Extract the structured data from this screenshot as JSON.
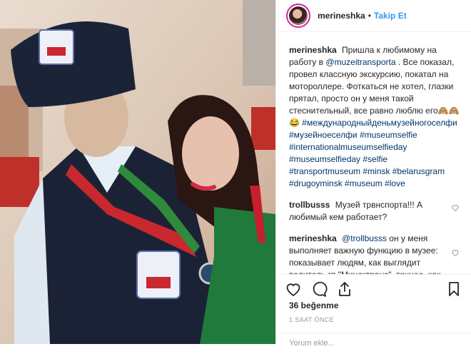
{
  "header": {
    "username": "merineshka",
    "separator": "•",
    "follow_label": "Takip Et"
  },
  "caption": {
    "username": "merineshka",
    "text_before_mention": "Пришла к любимому на работу в ",
    "mention": "@muzeitransporta",
    "text_after_mention": ". Все показал, провел классную экскурсию, покатал на мотороллере. Фоткаться не хотел, глазки прятал, просто он у меня такой стеснительный, все равно люблю его🙈🙈😂",
    "hashtags": "#международныйденьмузейногоселфи #музейноеселфи #museumselfie #internationalmuseumselfieday #museumselfieday #selfie #transportmuseum #minsk #belarusgram #drugoyminsk #museum #love"
  },
  "comments": [
    {
      "username": "trollbusss",
      "mention": "",
      "text": "Музей трвнспорта!!! А любимый кем работает?"
    },
    {
      "username": "merineshka",
      "mention": "@trollbusss",
      "text": " он у меня выполняет важную функцию в музее: показывает людям, как выглядит водитель гп \"Минсктранс\", точнее, как выглядел несколько лет назад, до того, как ему сменили форму. Когда-то он был обычным водителем"
    }
  ],
  "likes": "36 beğenme",
  "time": "1 SAAT ÖNCE",
  "add_comment_placeholder": "Yorum ekle..."
}
